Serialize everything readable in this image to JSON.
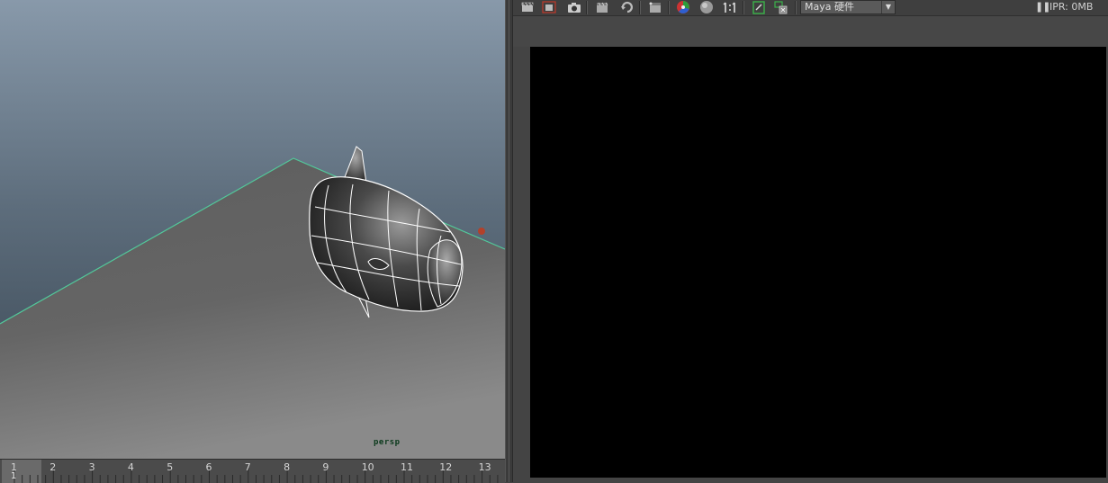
{
  "viewport": {
    "camera_label": "persp"
  },
  "timeline": {
    "ticks": [
      "1",
      "2",
      "3",
      "4",
      "5",
      "6",
      "7",
      "8",
      "9",
      "10",
      "11",
      "12",
      "13"
    ],
    "current_frame": "1"
  },
  "render_toolbar": {
    "icons": [
      "clapper-icon",
      "redo-render-icon",
      "snapshot-icon",
      "region-render-icon",
      "refresh-icon",
      "ipr-render-icon",
      "rgb-channel-icon",
      "alpha-channel-icon",
      "one-to-one-icon",
      "keep-image-icon",
      "remove-image-icon"
    ],
    "renderer": "Maya 硬件",
    "ipr_status": "IPR: 0MB"
  }
}
